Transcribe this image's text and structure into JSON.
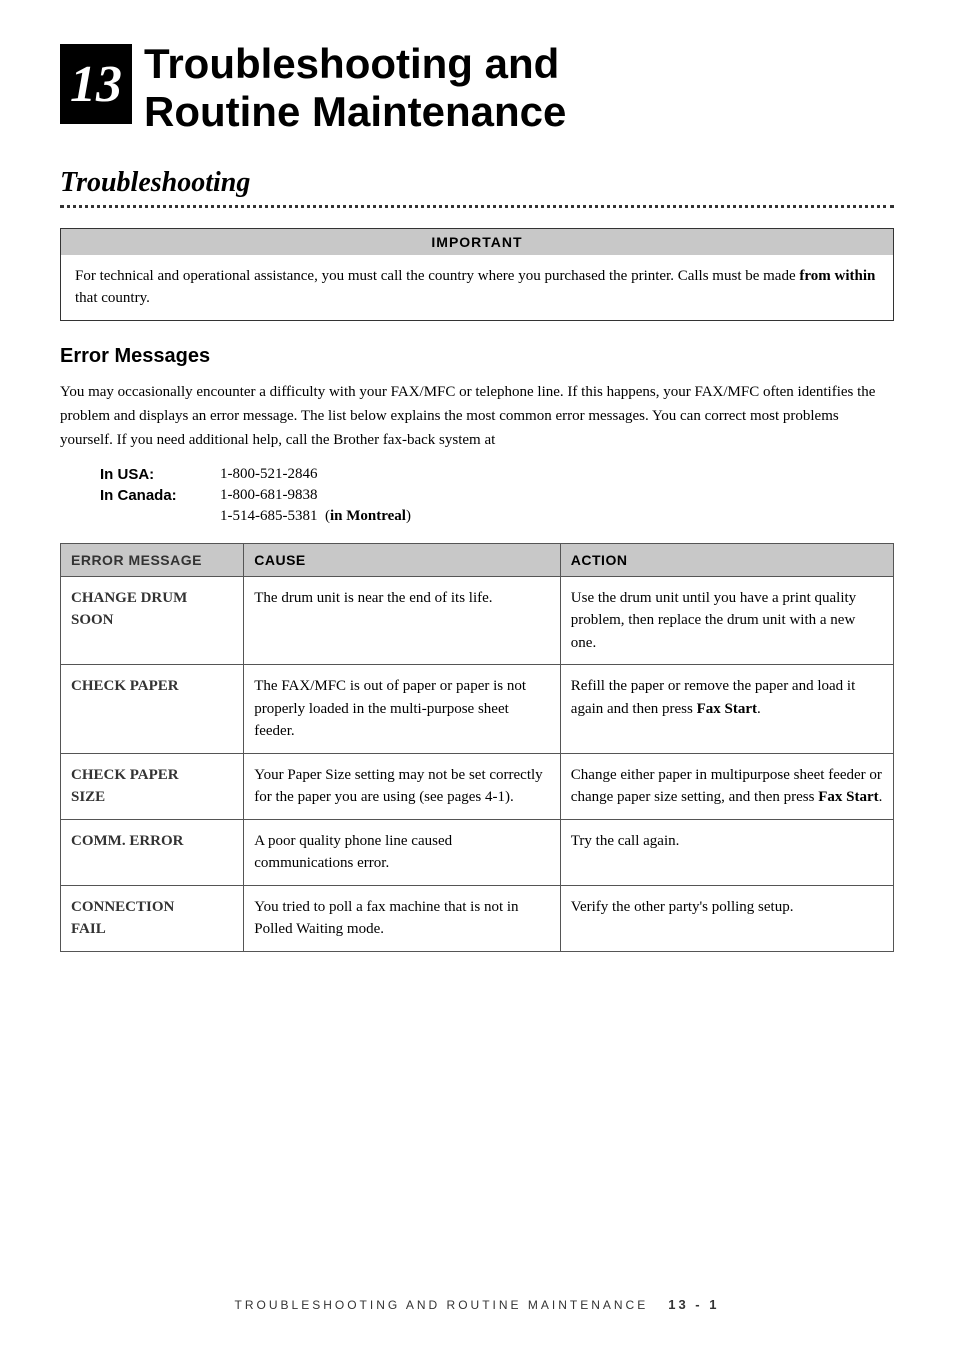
{
  "header": {
    "chapter_number": "13",
    "chapter_title": "Troubleshooting and\nRoutine Maintenance"
  },
  "section": {
    "title": "Troubleshooting"
  },
  "important_box": {
    "header": "IMPORTANT",
    "body": "For technical and operational assistance, you must call the country where you purchased the printer. Calls must be made from within that country."
  },
  "subsection": {
    "title": "Error Messages",
    "intro": "You may occasionally encounter a difficulty with your FAX/MFC or telephone line. If this happens, your FAX/MFC often identifies the problem and displays an error message. The list below explains the most common error messages. You can correct most problems yourself. If you need additional help, call the Brother fax-back system at"
  },
  "contacts": [
    {
      "label": "In USA:",
      "value": "1-800-521-2846"
    },
    {
      "label": "In Canada:",
      "value": "1-800-681-9838"
    },
    {
      "label": "",
      "value": "1-514-685-5381  (in Montreal)"
    }
  ],
  "table": {
    "columns": [
      "ERROR MESSAGE",
      "CAUSE",
      "ACTION"
    ],
    "rows": [
      {
        "error": "CHANGE DRUM\nSOON",
        "cause": "The drum unit is near the end of its life.",
        "action": "Use the drum unit until you have a print quality problem, then replace the drum unit with a new one."
      },
      {
        "error": "CHECK PAPER",
        "cause": "The FAX/MFC is out of paper or paper is not properly loaded in the multi-purpose sheet feeder.",
        "action": "Refill the paper or remove the paper and load it again and then press Fax Start.",
        "action_bold": "Fax Start"
      },
      {
        "error": "CHECK PAPER\nSIZE",
        "cause": "Your Paper Size setting may not be set correctly for the paper you are using (see pages 4-1).",
        "action": "Change either paper in multipurpose sheet feeder or change paper size setting, and then press Fax Start.",
        "action_bold": "Fax Start"
      },
      {
        "error": "COMM. ERROR",
        "cause": "A poor quality phone line caused communications error.",
        "action": "Try the call again."
      },
      {
        "error": "CONNECTION\nFAIL",
        "cause": "You tried to poll a fax machine that is not in Polled Waiting mode.",
        "action": "Verify the other party's polling setup."
      }
    ]
  },
  "footer": {
    "text": "TROUBLESHOOTING AND ROUTINE MAINTENANCE",
    "page": "13 - 1"
  }
}
